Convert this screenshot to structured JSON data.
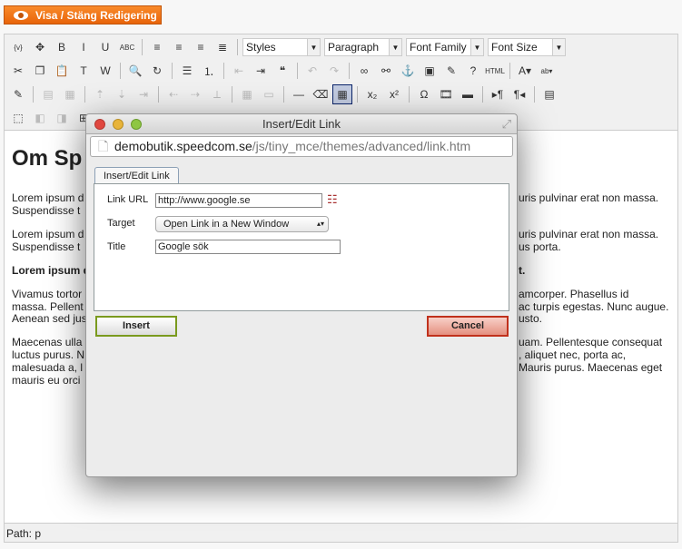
{
  "toggle_button": {
    "label": "Visa / Stäng Redigering",
    "icon": "eye-icon"
  },
  "toolbar": {
    "row1": [
      {
        "n": "template-icon",
        "g": "{v}"
      },
      {
        "n": "insert-icon",
        "g": "✥"
      },
      {
        "n": "bold-icon",
        "g": "B"
      },
      {
        "n": "italic-icon",
        "g": "I"
      },
      {
        "n": "underline-icon",
        "g": "U"
      },
      {
        "n": "strikethrough-icon",
        "g": "ABC"
      },
      "|",
      {
        "n": "align-left-icon",
        "g": "≡"
      },
      {
        "n": "align-center-icon",
        "g": "≡"
      },
      {
        "n": "align-right-icon",
        "g": "≡"
      },
      {
        "n": "align-justify-icon",
        "g": "≣"
      },
      "|"
    ],
    "selects": [
      {
        "n": "styles-select",
        "label": "Styles",
        "w": 86
      },
      {
        "n": "format-select",
        "label": "Paragraph",
        "w": 86
      },
      {
        "n": "font-family-select",
        "label": "Font Family",
        "w": 86
      },
      {
        "n": "font-size-select",
        "label": "Font Size",
        "w": 86
      }
    ],
    "row2": [
      {
        "n": "cut-icon",
        "g": "✂"
      },
      {
        "n": "copy-icon",
        "g": "❐"
      },
      {
        "n": "paste-icon",
        "g": "📋"
      },
      {
        "n": "paste-text-icon",
        "g": "T"
      },
      {
        "n": "paste-word-icon",
        "g": "W"
      },
      "|",
      {
        "n": "find-icon",
        "g": "🔍"
      },
      {
        "n": "replace-icon",
        "g": "↻"
      },
      "|",
      {
        "n": "bullet-list-icon",
        "g": "☰"
      },
      {
        "n": "numbered-list-icon",
        "g": "⒈"
      },
      "|",
      {
        "n": "outdent-icon",
        "g": "⇤",
        "d": 1
      },
      {
        "n": "indent-icon",
        "g": "⇥"
      },
      {
        "n": "blockquote-icon",
        "g": "❝"
      },
      "|",
      {
        "n": "undo-icon",
        "g": "↶",
        "d": 1
      },
      {
        "n": "redo-icon",
        "g": "↷",
        "d": 1
      },
      "|",
      {
        "n": "link-icon",
        "g": "∞"
      },
      {
        "n": "unlink-icon",
        "g": "⚯"
      },
      {
        "n": "anchor-icon",
        "g": "⚓"
      },
      {
        "n": "image-icon",
        "g": "▣"
      },
      {
        "n": "cleanup-icon",
        "g": "✎"
      },
      {
        "n": "help-icon",
        "g": "?"
      },
      {
        "n": "html-icon",
        "g": "HTML"
      },
      "|",
      {
        "n": "text-color-icon",
        "g": "A▾"
      },
      {
        "n": "background-color-icon",
        "g": "ab▾"
      }
    ],
    "row3": [
      {
        "n": "edit-icon",
        "g": "✎"
      },
      "|",
      {
        "n": "row-props-icon",
        "g": "▤",
        "d": 1
      },
      {
        "n": "cell-props-icon",
        "g": "▦",
        "d": 1
      },
      "|",
      {
        "n": "insert-row-before-icon",
        "g": "⇡",
        "d": 1
      },
      {
        "n": "insert-row-after-icon",
        "g": "⇣",
        "d": 1
      },
      {
        "n": "delete-row-icon",
        "g": "⇥",
        "d": 1
      },
      "|",
      {
        "n": "insert-col-before-icon",
        "g": "⇠",
        "d": 1
      },
      {
        "n": "insert-col-after-icon",
        "g": "⇢",
        "d": 1
      },
      {
        "n": "delete-col-icon",
        "g": "⟂",
        "d": 1
      },
      "|",
      {
        "n": "split-cells-icon",
        "g": "▦",
        "d": 1
      },
      {
        "n": "merge-cells-icon",
        "g": "▭",
        "d": 1
      },
      "|",
      {
        "n": "horizontal-rule-icon",
        "g": "—"
      },
      {
        "n": "remove-format-icon",
        "g": "⌫"
      },
      {
        "n": "table-icon",
        "g": "▦",
        "on": 1
      },
      "|",
      {
        "n": "subscript-icon",
        "g": "x₂"
      },
      {
        "n": "superscript-icon",
        "g": "x²"
      },
      "|",
      {
        "n": "special-char-icon",
        "g": "Ω"
      },
      {
        "n": "media-icon",
        "g": "🎞"
      },
      {
        "n": "advanced-hr-icon",
        "g": "▬"
      },
      "|",
      {
        "n": "ltr-icon",
        "g": "▸¶"
      },
      {
        "n": "rtl-icon",
        "g": "¶◂"
      },
      "|",
      {
        "n": "fullscreen-icon",
        "g": "▤"
      }
    ],
    "row4": [
      {
        "n": "visual-aid-icon",
        "g": "⬚"
      },
      {
        "n": "layer-back-icon",
        "g": "◧",
        "d": 1
      },
      {
        "n": "layer-forward-icon",
        "g": "◨",
        "d": 1
      },
      {
        "n": "insert-layer-icon",
        "g": "⊞"
      }
    ]
  },
  "content": {
    "heading": "Om Sp",
    "lines": [
      {
        "l": "Lorem ipsum d",
        "r": "uris pulvinar erat non massa."
      },
      {
        "l": "Suspendisse t",
        "r": ""
      },
      {
        "l": "Lorem ipsum d",
        "r": "uris pulvinar erat non massa."
      },
      {
        "l": "Suspendisse t",
        "r": "us porta."
      },
      {
        "l": "Lorem ipsum d",
        "r": "t.",
        "b": 1
      },
      {
        "l": "Vivamus tortor",
        "r": "amcorper. Phasellus id"
      },
      {
        "l": "massa. Pellent",
        "r": "ac turpis egestas. Nunc augue."
      },
      {
        "l": "Aenean sed jus",
        "r": "usto."
      },
      {
        "l": "Maecenas ulla",
        "r": "uam. Pellentesque consequat"
      },
      {
        "l": "luctus purus. N",
        "r": ", aliquet nec, porta ac,"
      },
      {
        "l": "malesuada a, l",
        "r": "Mauris purus. Maecenas eget"
      },
      {
        "l": "mauris eu orci",
        "r": ""
      }
    ]
  },
  "statusbar": {
    "path": "Path: p"
  },
  "dialog": {
    "title": "Insert/Edit Link",
    "url_host": "demobutik.speedcom.se",
    "url_path": "/js/tiny_mce/themes/advanced/link.htm",
    "tab": "Insert/Edit Link",
    "link_url_label": "Link URL",
    "link_url_value": "http://www.google.se",
    "target_label": "Target",
    "target_value": "Open Link in a New Window",
    "title_label": "Title",
    "title_value": "Google sök",
    "insert": "Insert",
    "cancel": "Cancel"
  },
  "colors": {
    "accent": "#f7841f",
    "insert_border": "#7a9a1e",
    "cancel_border": "#c0311c"
  }
}
